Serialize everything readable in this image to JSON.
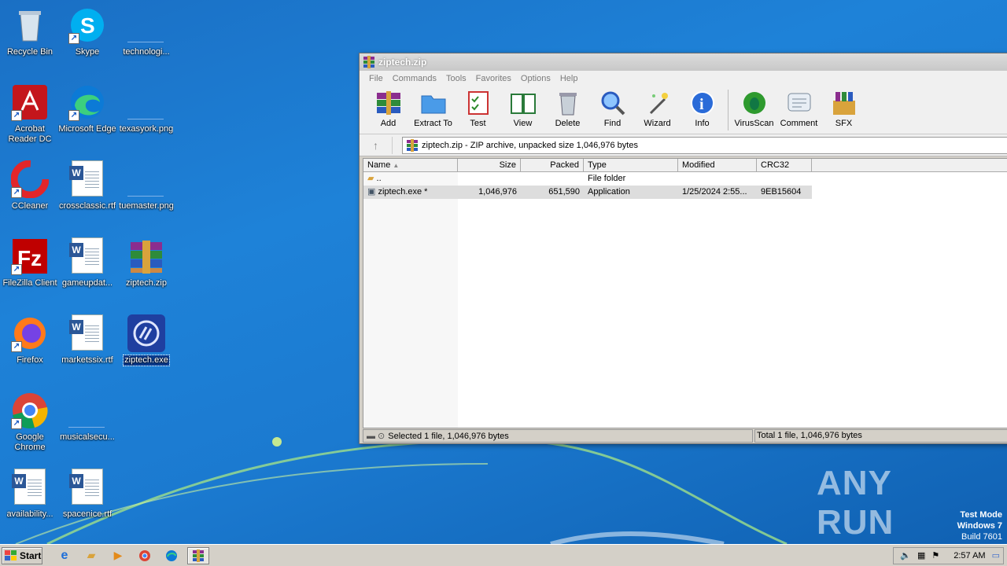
{
  "desktop": {
    "icons": [
      {
        "label": "Recycle Bin"
      },
      {
        "label": "Skype"
      },
      {
        "label": "technologi..."
      },
      {
        "label": "Acrobat Reader DC"
      },
      {
        "label": "Microsoft Edge"
      },
      {
        "label": "texasyork.png"
      },
      {
        "label": "CCleaner"
      },
      {
        "label": "crossclassic.rtf"
      },
      {
        "label": "tuemaster.png"
      },
      {
        "label": "FileZilla Client"
      },
      {
        "label": "gameupdat..."
      },
      {
        "label": "ziptech.zip"
      },
      {
        "label": "Firefox"
      },
      {
        "label": "marketssix.rtf"
      },
      {
        "label": "ziptech.exe"
      },
      {
        "label": "Google Chrome"
      },
      {
        "label": "musicalsecu..."
      },
      {
        "label": "availability..."
      },
      {
        "label": "spacenice.rtf"
      }
    ]
  },
  "window": {
    "title": "ziptech.zip",
    "menu": [
      "File",
      "Commands",
      "Tools",
      "Favorites",
      "Options",
      "Help"
    ],
    "toolbar": [
      "Add",
      "Extract To",
      "Test",
      "View",
      "Delete",
      "Find",
      "Wizard",
      "Info",
      "VirusScan",
      "Comment",
      "SFX"
    ],
    "address": "ziptech.zip - ZIP archive, unpacked size 1,046,976 bytes",
    "columns": [
      "Name",
      "Size",
      "Packed",
      "Type",
      "Modified",
      "CRC32"
    ],
    "rows": [
      {
        "name": "..",
        "size": "",
        "packed": "",
        "type": "File folder",
        "modified": "",
        "crc": ""
      },
      {
        "name": "ziptech.exe *",
        "size": "1,046,976",
        "packed": "651,590",
        "type": "Application",
        "modified": "1/25/2024 2:55...",
        "crc": "9EB15604"
      }
    ],
    "status_left": "Selected 1 file, 1,046,976 bytes",
    "status_right": "Total 1 file, 1,046,976 bytes"
  },
  "watermark": {
    "brand": "ANY RUN",
    "line1": "Test Mode",
    "line2": "Windows 7",
    "line3": "Build 7601"
  },
  "taskbar": {
    "start_label": "Start",
    "clock": "2:57 AM"
  },
  "colors": {
    "desktop": "#1b7ad0",
    "window_bg": "#f0f0f0",
    "selection": "#0a3d91"
  }
}
